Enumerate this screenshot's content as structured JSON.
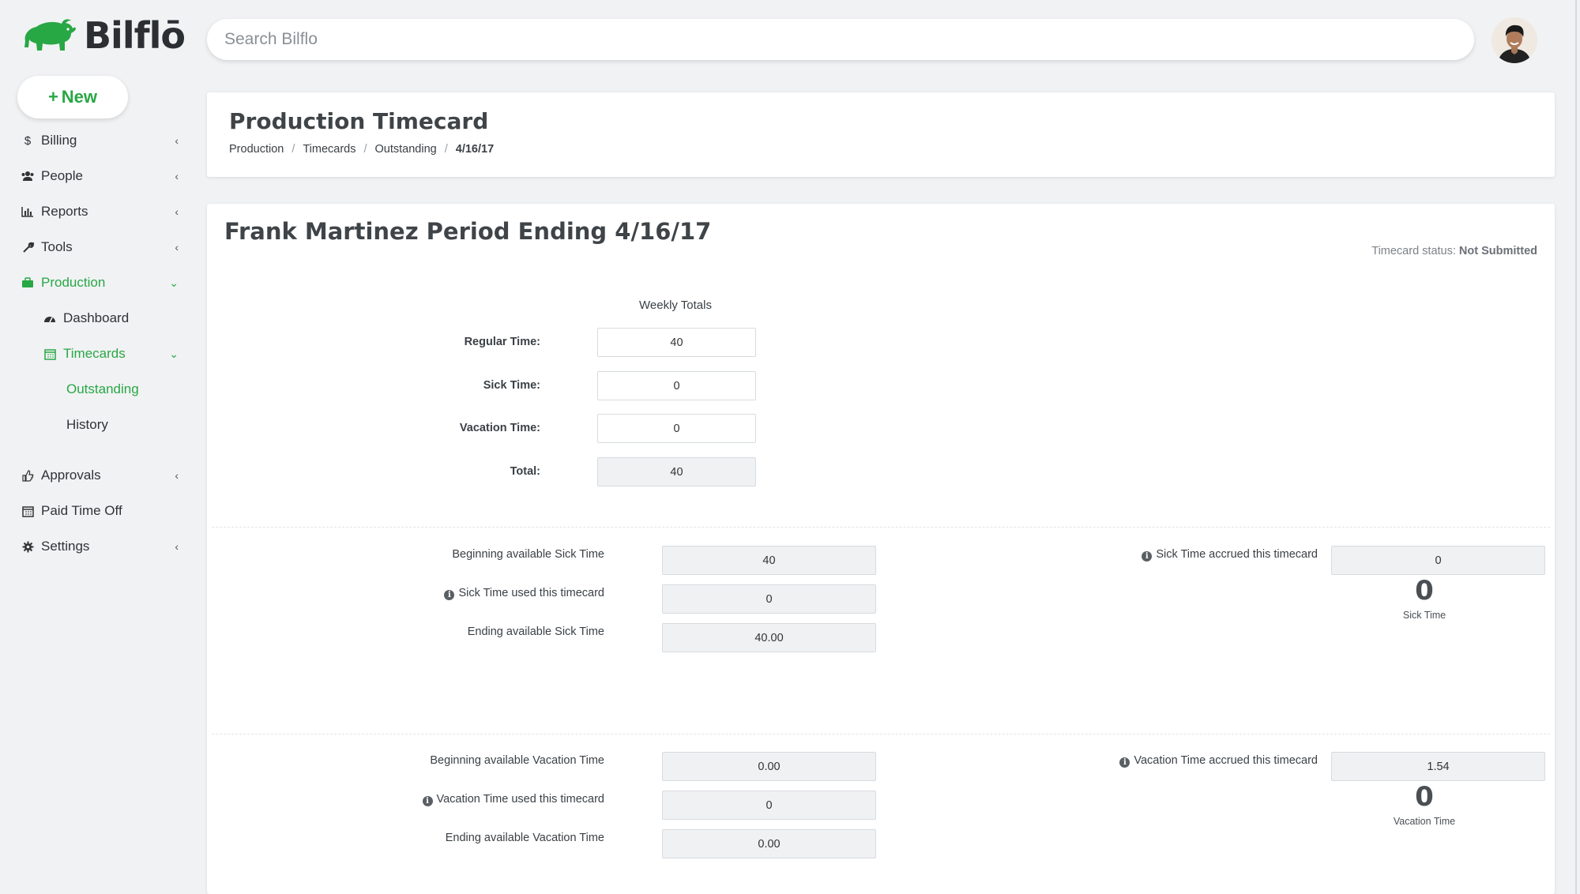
{
  "app": {
    "name": "Bilflō",
    "brand_color": "#28a745",
    "search_placeholder": "Search Bilflo"
  },
  "sidebar": {
    "new_button": "New",
    "items": [
      {
        "label": "Billing",
        "icon": "dollar-icon"
      },
      {
        "label": "People",
        "icon": "users-icon"
      },
      {
        "label": "Reports",
        "icon": "bar-chart-icon"
      },
      {
        "label": "Tools",
        "icon": "wrench-icon"
      },
      {
        "label": "Production",
        "icon": "briefcase-icon",
        "active": true
      },
      {
        "label": "Dashboard",
        "icon": "dashboard-icon"
      },
      {
        "label": "Timecards",
        "icon": "calendar-icon",
        "active": true
      },
      {
        "label": "Outstanding",
        "active": true
      },
      {
        "label": "History"
      },
      {
        "label": "Approvals",
        "icon": "thumbs-up-icon"
      },
      {
        "label": "Paid Time Off",
        "icon": "calendar-icon"
      },
      {
        "label": "Settings",
        "icon": "gear-icon"
      }
    ]
  },
  "header": {
    "title": "Production Timecard",
    "breadcrumb": [
      "Production",
      "Timecards",
      "Outstanding",
      "4/16/17"
    ]
  },
  "timecard": {
    "title": "Frank Martinez Period Ending 4/16/17",
    "status_label": "Timecard status:",
    "status_value": "Not Submitted",
    "weekly_totals_header": "Weekly Totals",
    "regular_label": "Regular Time:",
    "regular_value": "40",
    "sick_label": "Sick Time:",
    "sick_value": "0",
    "vacation_label": "Vacation Time:",
    "vacation_value": "0",
    "total_label": "Total:",
    "total_value": "40"
  },
  "sick": {
    "beginning_label": "Beginning available Sick Time",
    "beginning_value": "40",
    "used_label": "Sick Time used this timecard",
    "used_value": "0",
    "ending_label": "Ending available Sick Time",
    "ending_value": "40.00",
    "accrued_label": "Sick Time accrued this timecard",
    "accrued_value": "0",
    "balance": "0",
    "balance_caption": "Sick Time"
  },
  "vacation": {
    "beginning_label": "Beginning available Vacation Time",
    "beginning_value": "0.00",
    "used_label": "Vacation Time used this timecard",
    "used_value": "0",
    "ending_label": "Ending available Vacation Time",
    "ending_value": "0.00",
    "accrued_label": "Vacation Time accrued this timecard",
    "accrued_value": "1.54",
    "balance": "0",
    "balance_caption": "Vacation Time"
  }
}
